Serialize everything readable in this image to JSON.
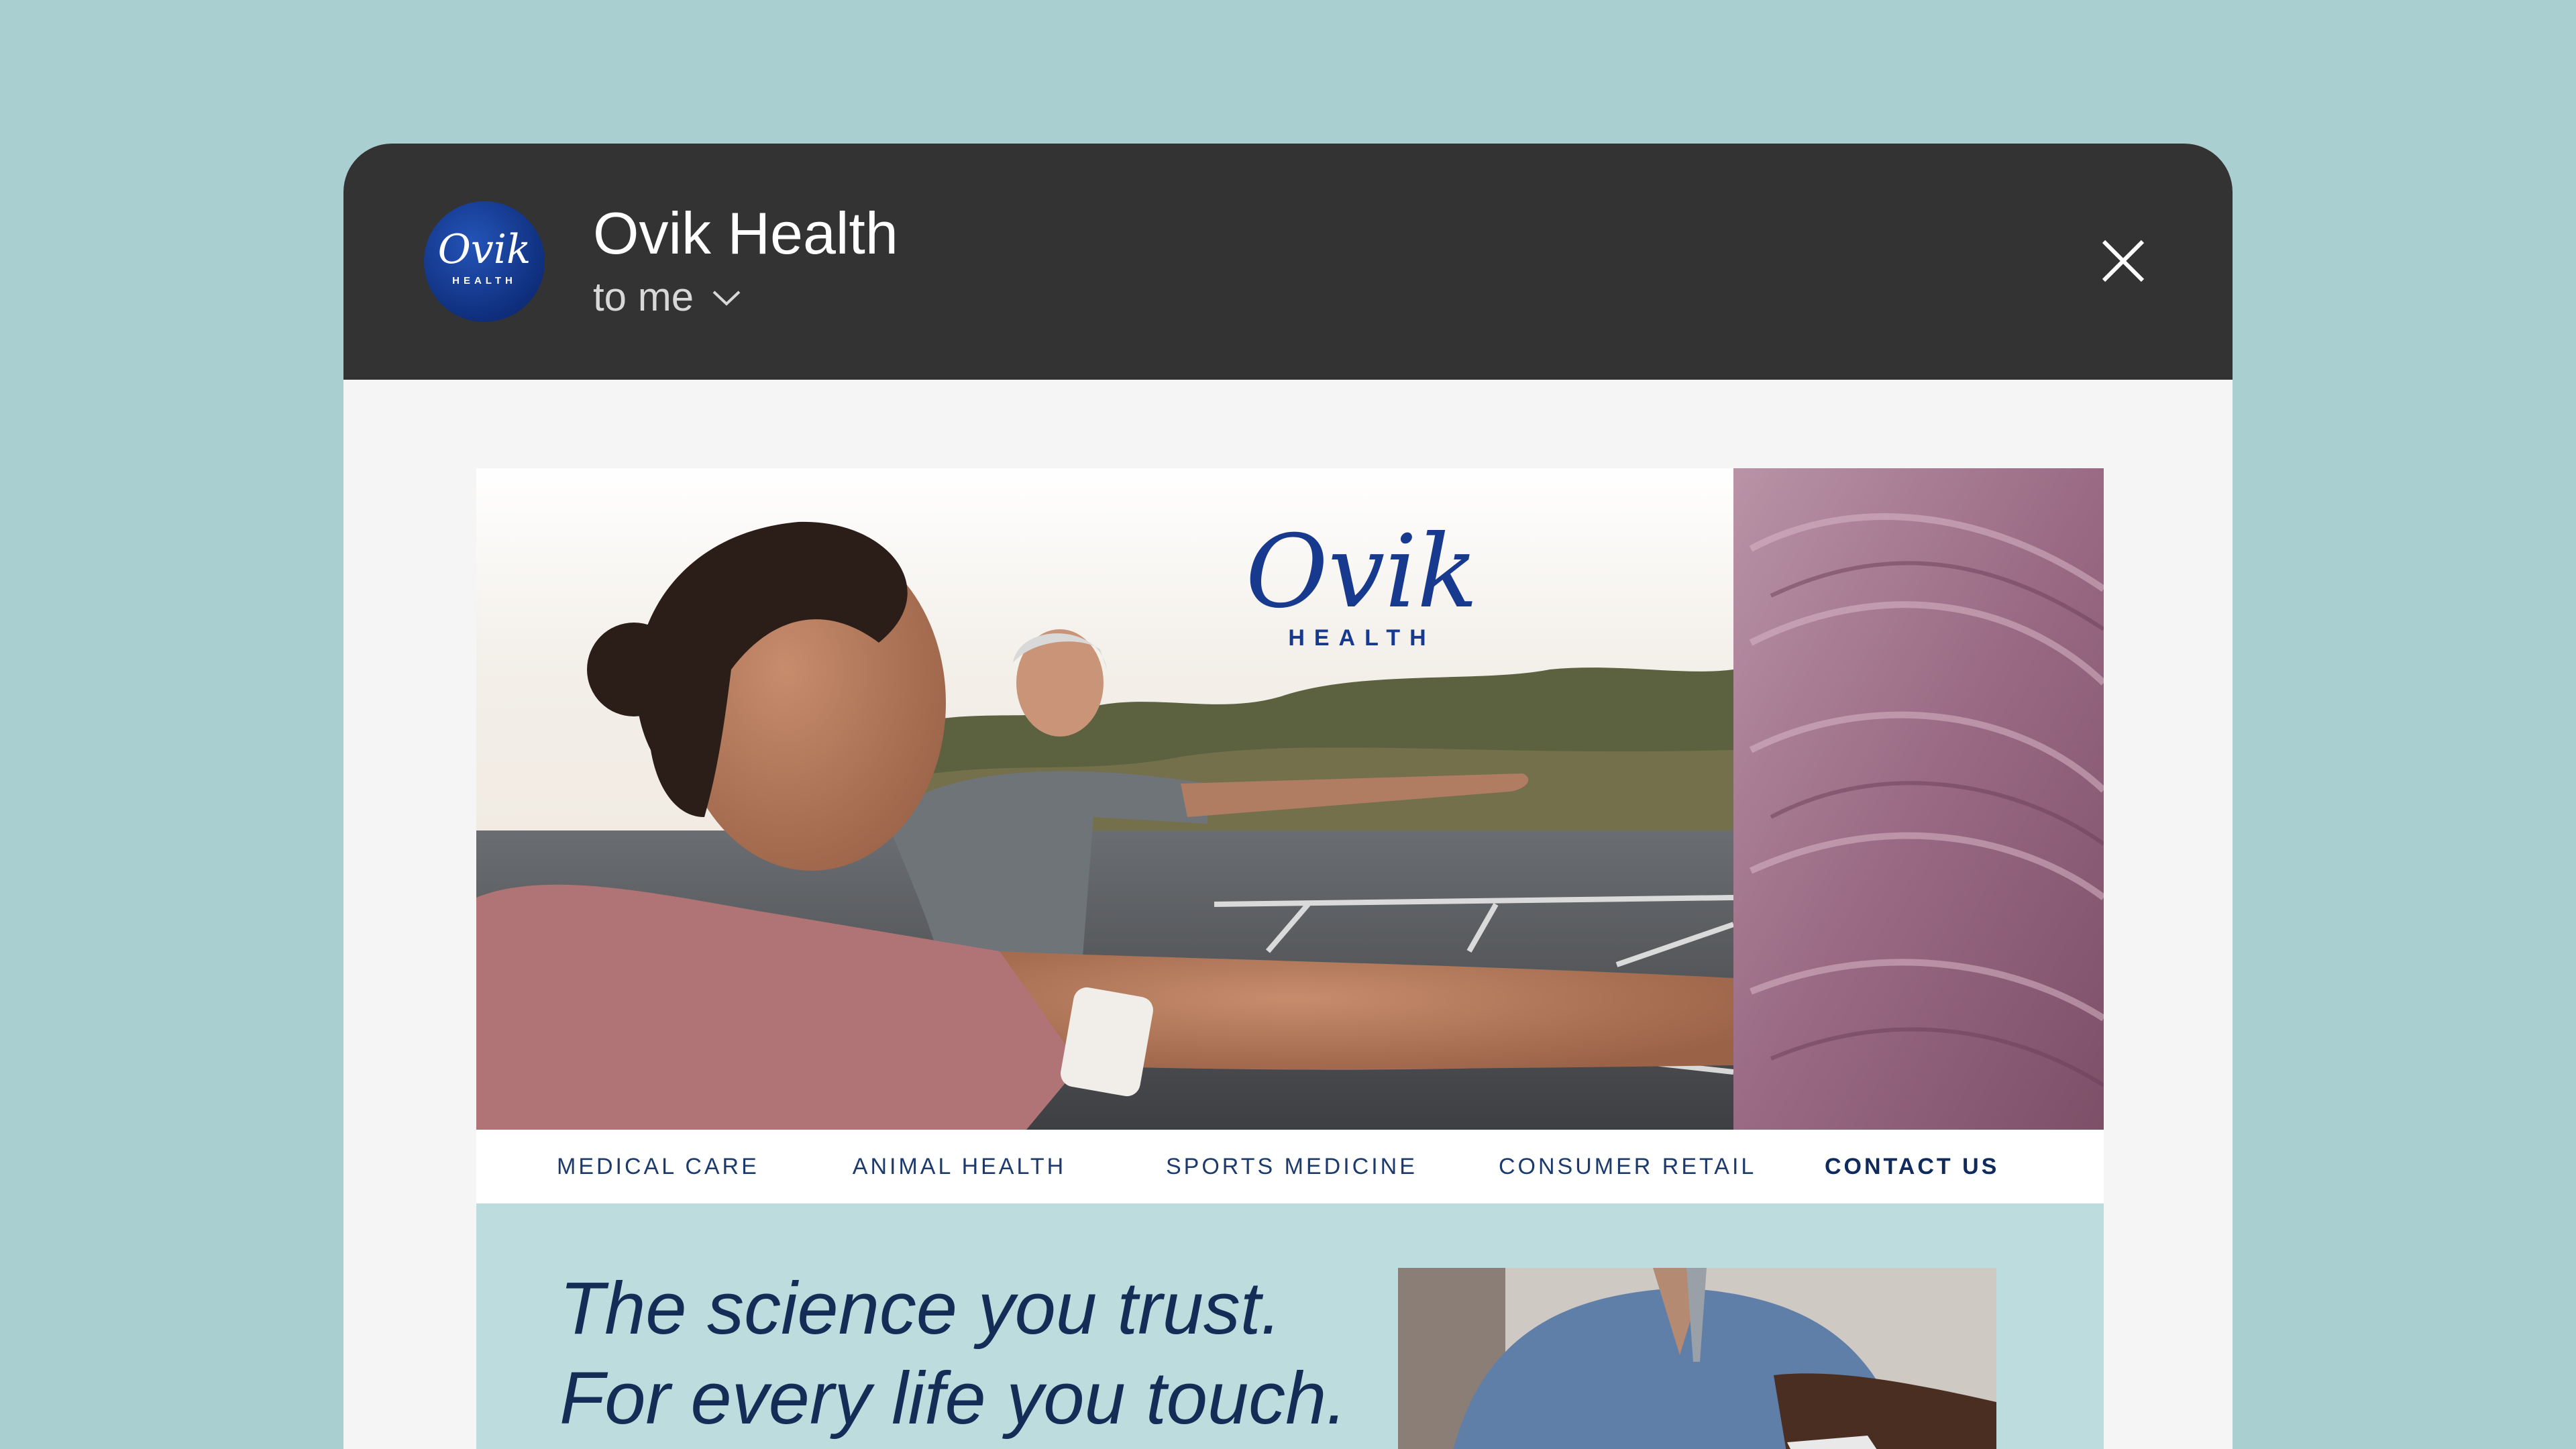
{
  "window": {
    "avatar_logo": {
      "script": "Ovik",
      "sub": "HEALTH",
      "color": "#143a94"
    },
    "sender": "Ovik Health",
    "recipient": "to me",
    "icons": [
      "chevron-down-icon",
      "close-icon"
    ]
  },
  "email": {
    "logo": {
      "script": "Ovik",
      "sub": "HEALTH",
      "color": "#173a8f"
    },
    "nav": {
      "items": [
        "MEDICAL CARE",
        "ANIMAL HEALTH",
        "SPORTS MEDICINE",
        "CONSUMER RETAIL",
        "CONTACT US"
      ]
    },
    "tagline": {
      "line1": "The science you trust.",
      "line2": "For every life you touch."
    }
  },
  "colors": {
    "background": "#aacfd1",
    "titlebar": "#333333",
    "accent_blue": "#1d3a6d",
    "panel_teal": "#bcdcdd",
    "texture_mauve": "#9a6a84"
  }
}
